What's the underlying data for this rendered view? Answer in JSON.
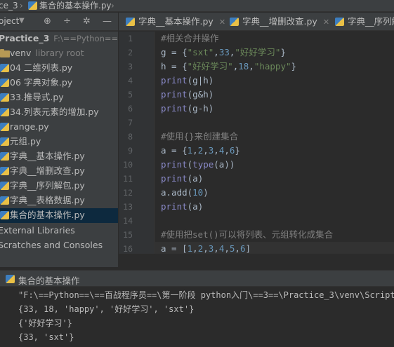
{
  "breadcrumb": {
    "project": "ce_3",
    "file": "集合的基本操作.py"
  },
  "project_panel": {
    "view_label": "oject",
    "tools": [
      "target-icon",
      "split-icon",
      "settings-icon",
      "minimize-icon"
    ]
  },
  "tree": {
    "root_label": "Practice_3",
    "root_path": "F:\\==Python==\\==",
    "items": [
      {
        "label": "venv",
        "suffix": "library root",
        "icon": "folder-icon"
      },
      {
        "label": "04 二维列表.py",
        "icon": "py-file-icon"
      },
      {
        "label": "06 字典对象.py",
        "icon": "py-file-icon"
      },
      {
        "label": "33.推导式.py",
        "icon": "py-file-icon"
      },
      {
        "label": "34.列表元素的增加.py",
        "icon": "py-file-icon"
      },
      {
        "label": "range.py",
        "icon": "py-file-icon"
      },
      {
        "label": "元组.py",
        "icon": "py-file-icon"
      },
      {
        "label": "字典__基本操作.py",
        "icon": "py-file-icon"
      },
      {
        "label": "字典__增删改查.py",
        "icon": "py-file-icon"
      },
      {
        "label": "字典__序列解包.py",
        "icon": "py-file-icon"
      },
      {
        "label": "字典__表格数据.py",
        "icon": "py-file-icon"
      },
      {
        "label": "集合的基本操作.py",
        "icon": "py-file-icon",
        "selected": true
      }
    ],
    "external_libraries": "External Libraries",
    "scratches": "Scratches and Consoles"
  },
  "tabs": [
    {
      "label": "字典__基本操作.py"
    },
    {
      "label": "字典__增删改查.py"
    },
    {
      "label": "字典__序列解"
    }
  ],
  "editor": {
    "line_numbers": [
      "1",
      "2",
      "3",
      "4",
      "5",
      "6",
      "7",
      "8",
      "9",
      "10",
      "11",
      "12",
      "13",
      "14",
      "15",
      "16"
    ],
    "current_line": 16
  },
  "run_panel": {
    "title": "集合的基本操作",
    "output": [
      "\"F:\\==Python==\\==百战程序员==\\第一阶段 python入门\\==3==\\Practice_3\\venv\\Scripts",
      "{33, 18, 'happy', '好好学习', 'sxt'}",
      "{'好好学习'}",
      "{33, 'sxt'}"
    ]
  },
  "colors": {
    "background": "#2b2b2b",
    "panel": "#3c3f41",
    "selection": "#0d293e",
    "comment": "#808080",
    "string": "#6a8759",
    "number": "#6897bb",
    "builtin": "#8888c6"
  }
}
